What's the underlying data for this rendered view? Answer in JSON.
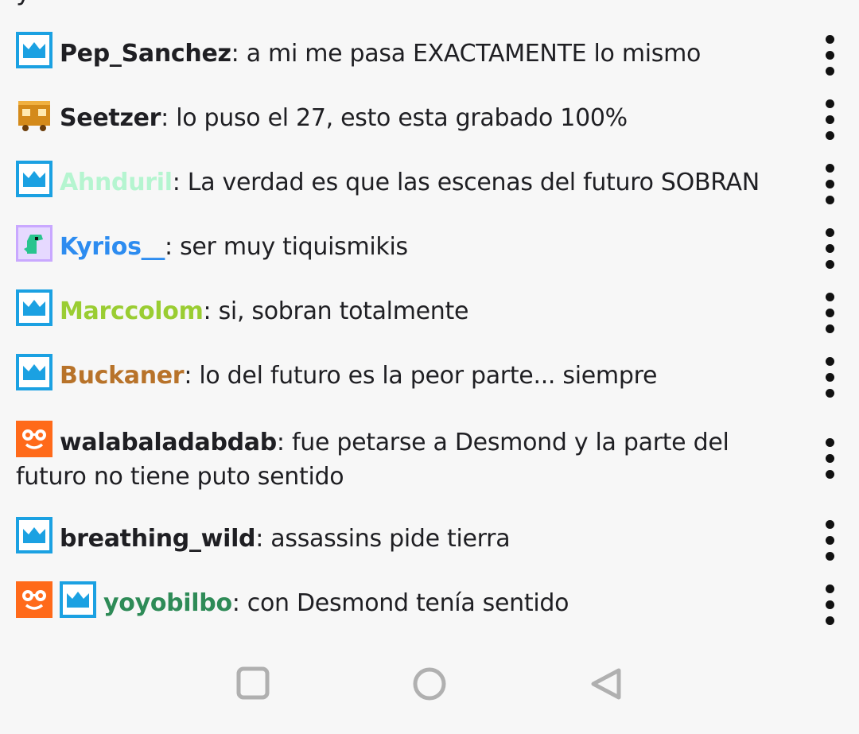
{
  "top_fragment": "y",
  "messages": [
    {
      "badges": [
        "prime"
      ],
      "user": "Pep_Sanchez",
      "user_color": "#1f1f23",
      "text": ": a mi me pasa EXACTAMENTE lo mismo"
    },
    {
      "badges": [
        "train"
      ],
      "user": "Seetzer",
      "user_color": "#1f1f23",
      "text": ": lo puso el 27, esto esta grabado 100%"
    },
    {
      "badges": [
        "prime"
      ],
      "user": "Ahnduril",
      "user_color": "#b5f5d0",
      "text": ": La verdad es que las escenas del futuro SOBRAN"
    },
    {
      "badges": [
        "dino"
      ],
      "user": "Kyrios__",
      "user_color": "#2d8cf0",
      "text": ": ser muy tiquismikis"
    },
    {
      "badges": [
        "prime"
      ],
      "user": "Marccolom",
      "user_color": "#9acd32",
      "text": ": si, sobran totalmente"
    },
    {
      "badges": [
        "prime"
      ],
      "user": "Buckaner",
      "user_color": "#b8732a",
      "text": ": lo del futuro es la peor parte... siempre"
    },
    {
      "badges": [
        "glasses"
      ],
      "user": "walabaladabdab",
      "user_color": "#1f1f23",
      "text": ": fue petarse a Desmond y la parte del futuro no tiene puto sentido"
    },
    {
      "badges": [
        "prime"
      ],
      "user": "breathing_wild",
      "user_color": "#1f1f23",
      "text": ": assassins pide tierra"
    },
    {
      "badges": [
        "glasses",
        "prime"
      ],
      "user": "yoyobilbo",
      "user_color": "#2e8b57",
      "text": ": con Desmond tenía sentido"
    }
  ],
  "colors": {
    "prime_badge": "#1ba1e2",
    "glasses_badge": "#ff6a1a",
    "background": "#f7f7f7",
    "text": "#1f1f23",
    "nav_icon": "#b0b0b0"
  },
  "icons": {
    "more": "more-vertical-icon",
    "nav_recents": "square-icon",
    "nav_home": "circle-icon",
    "nav_back": "triangle-back-icon"
  }
}
